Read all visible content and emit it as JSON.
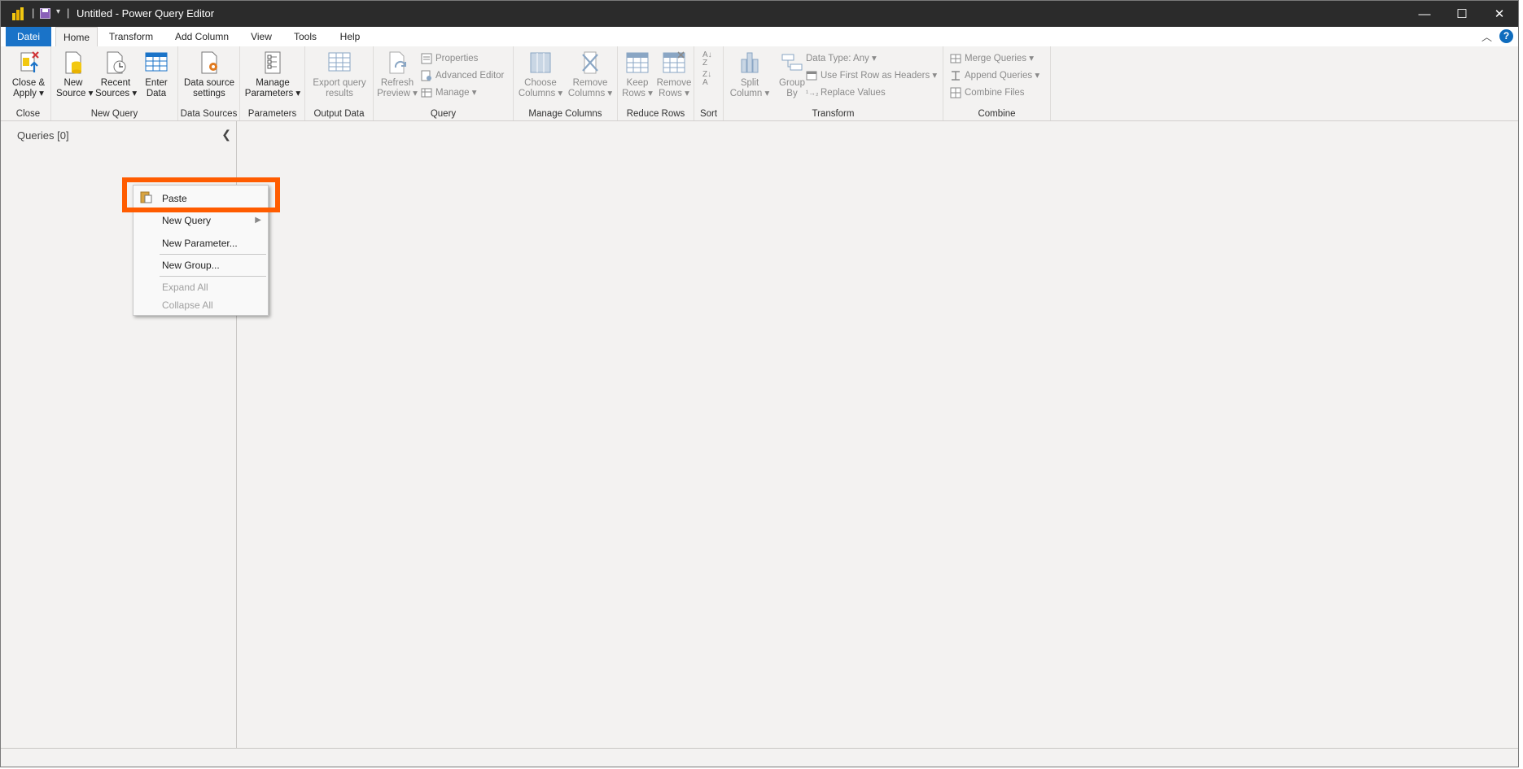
{
  "window": {
    "title": "Untitled - Power Query Editor"
  },
  "tabs": [
    "Datei",
    "Home",
    "Transform",
    "Add Column",
    "View",
    "Tools",
    "Help"
  ],
  "help_glyph": "?",
  "groups": {
    "close": {
      "label": "Close",
      "close_apply": "Close &",
      "close_apply2": "Apply"
    },
    "new_query": {
      "label": "New Query",
      "new_source": "New",
      "new_source2": "Source",
      "recent_sources": "Recent",
      "recent_sources2": "Sources",
      "enter_data": "Enter",
      "enter_data2": "Data"
    },
    "data_sources": {
      "label": "Data Sources",
      "settings": "Data source",
      "settings2": "settings"
    },
    "parameters": {
      "label": "Parameters",
      "manage": "Manage",
      "manage2": "Parameters"
    },
    "output_data": {
      "label": "Output Data",
      "export": "Export query",
      "export2": "results"
    },
    "query": {
      "label": "Query",
      "refresh": "Refresh",
      "refresh2": "Preview",
      "properties": "Properties",
      "advanced_editor": "Advanced Editor",
      "manage": "Manage"
    },
    "manage_columns": {
      "label": "Manage Columns",
      "choose": "Choose",
      "choose2": "Columns",
      "remove": "Remove",
      "remove2": "Columns"
    },
    "reduce_rows": {
      "label": "Reduce Rows",
      "keep": "Keep",
      "keep2": "Rows",
      "remove": "Remove",
      "remove2": "Rows"
    },
    "sort": {
      "label": "Sort"
    },
    "transform": {
      "label": "Transform",
      "split": "Split",
      "split2": "Column",
      "group_by": "Group",
      "group_by2": "By",
      "data_type": "Data Type: Any",
      "first_row": "Use First Row as Headers",
      "replace": "Replace Values"
    },
    "combine": {
      "label": "Combine",
      "merge": "Merge Queries",
      "append": "Append Queries",
      "combine_files": "Combine Files"
    }
  },
  "queries_pane": {
    "title": "Queries [0]"
  },
  "context_menu": {
    "paste": "Paste",
    "new_query": "New Query",
    "new_parameter": "New Parameter...",
    "new_group": "New Group...",
    "expand_all": "Expand All",
    "collapse_all": "Collapse All"
  },
  "colors": {
    "file_tab": "#1a73c8",
    "highlight": "#ff5c00",
    "titlebar": "#2b2b2b"
  }
}
